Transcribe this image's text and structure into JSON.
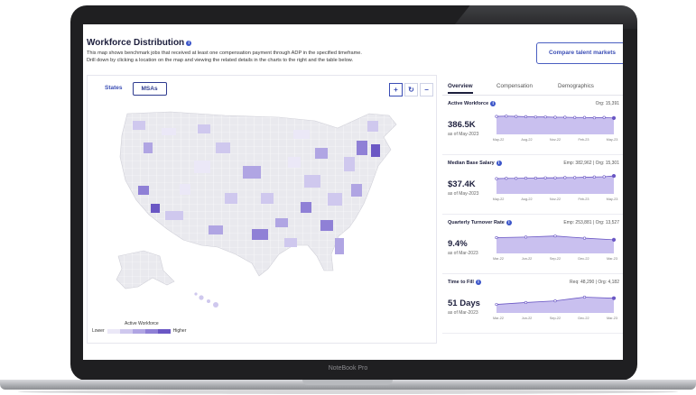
{
  "header": {
    "title": "Workforce Distribution",
    "info_icon": "i",
    "description_line1": "This map shows benchmark jobs that received at least one compensation payment through ADP in the specified timeframe.",
    "description_line2": "Drill down by clicking a location on the map and viewing the related details in the charts to the right and the table below.",
    "compare_button": "Compare talent markets"
  },
  "map": {
    "toggle": [
      "States",
      "MSAs"
    ],
    "toggle_active": "MSAs",
    "zoom_in": "+",
    "reset": "↻",
    "zoom_out": "−",
    "legend_title": "Active Workforce",
    "legend_low": "Lower",
    "legend_high": "Higher",
    "legend_colors": [
      "#ebe8f7",
      "#cfc8ee",
      "#b0a5e3",
      "#8f80d6",
      "#6a57c4"
    ]
  },
  "tabs": [
    "Overview",
    "Compensation",
    "Demographics"
  ],
  "tabs_active": "Overview",
  "metrics": [
    {
      "name": "Active Workforce",
      "org": "Org: 15,391",
      "value": "386.5K",
      "as_of": "as of May-2023",
      "x_labels": [
        "May-22",
        "Aug-22",
        "Nov-22",
        "Feb-23",
        "May-23"
      ],
      "values": [
        0.8,
        0.81,
        0.8,
        0.79,
        0.78,
        0.78,
        0.77,
        0.77,
        0.76,
        0.76,
        0.75,
        0.76,
        0.74
      ]
    },
    {
      "name": "Median Base Salary",
      "org": "Emp: 382,962  |  Org: 15,301",
      "value": "$37.4K",
      "as_of": "as of May-2023",
      "x_labels": [
        "May-22",
        "Aug-22",
        "Nov-22",
        "Feb-23",
        "May-23"
      ],
      "values": [
        0.7,
        0.71,
        0.71,
        0.72,
        0.72,
        0.73,
        0.73,
        0.74,
        0.74,
        0.75,
        0.76,
        0.77,
        0.8
      ]
    },
    {
      "name": "Quarterly Turnover Rate",
      "org": "Emp: 253,881  |  Org: 13,527",
      "value": "9.4%",
      "as_of": "as of Mar-2023",
      "x_labels": [
        "Mar-22",
        "Jun-22",
        "Sep-22",
        "Dec-22",
        "Mar-23"
      ],
      "values": [
        0.72,
        0.74,
        0.78,
        0.7,
        0.64
      ]
    },
    {
      "name": "Time to Fill",
      "org": "Req: 48,290  |  Org: 4,182",
      "value": "51 Days",
      "as_of": "as of Mar-2023",
      "x_labels": [
        "Mar-22",
        "Jun-22",
        "Sep-22",
        "Dec-22",
        "Mar-23"
      ],
      "values": [
        0.45,
        0.52,
        0.58,
        0.72,
        0.68
      ]
    }
  ],
  "laptop_brand": "NoteBook Pro"
}
